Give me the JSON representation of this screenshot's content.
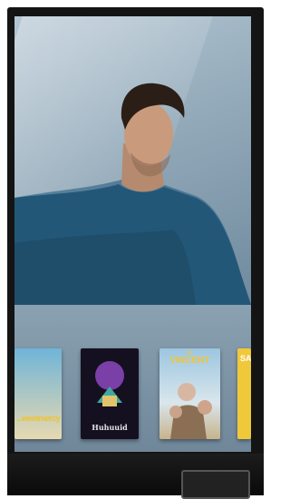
{
  "tiles": [
    {
      "title": "...weetmercy",
      "accent": "#f0c22d"
    },
    {
      "title": "Huhuuid",
      "accent": "#e6e6e6"
    },
    {
      "small": "ST",
      "title": "VINCENT",
      "accent": "#f2c531"
    },
    {
      "title": "SA",
      "accent": "#ffffff"
    }
  ]
}
